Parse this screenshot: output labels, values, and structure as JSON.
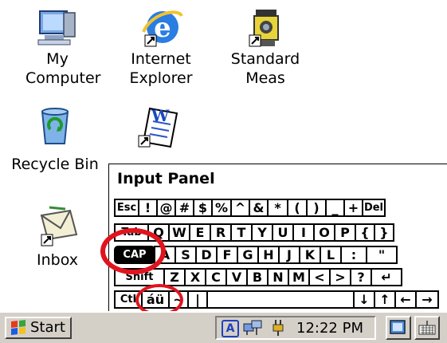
{
  "desktop": {
    "icons": [
      {
        "id": "my-computer",
        "label_line1": "My",
        "label_line2": "Computer"
      },
      {
        "id": "internet-explorer",
        "label_line1": "Internet",
        "label_line2": "Explorer"
      },
      {
        "id": "standard-meas",
        "label_line1": "Standard",
        "label_line2": "Meas"
      },
      {
        "id": "recycle-bin",
        "label_line1": "Recycle Bin"
      },
      {
        "id": "wordpad",
        "label_line1": ""
      },
      {
        "id": "inbox",
        "label_line1": "Inbox"
      }
    ]
  },
  "input_panel": {
    "title": "Input Panel",
    "rows": [
      [
        "Esc",
        "!",
        "@",
        "#",
        "$",
        "%",
        "^",
        "&",
        "*",
        "(",
        ")",
        "_",
        "+",
        "Del"
      ],
      [
        "Tab",
        "Q",
        "W",
        "E",
        "R",
        "T",
        "Y",
        "U",
        "I",
        "O",
        "P",
        "{",
        "}"
      ],
      [
        "CAP",
        "A",
        "S",
        "D",
        "F",
        "G",
        "H",
        "J",
        "K",
        "L",
        ":",
        "\""
      ],
      [
        "Shift",
        "Z",
        "X",
        "C",
        "V",
        "B",
        "N",
        "M",
        "<",
        ">",
        "?",
        "↵"
      ],
      [
        "Ctl",
        "áü",
        "~",
        "|",
        "",
        "↓",
        "↑",
        "←",
        "→"
      ]
    ]
  },
  "taskbar": {
    "start_label": "Start",
    "clock": "12:22 PM",
    "ime_label": "A"
  },
  "colors": {
    "highlight_ring": "#e0141e",
    "taskbar": "#d4d0c8"
  }
}
